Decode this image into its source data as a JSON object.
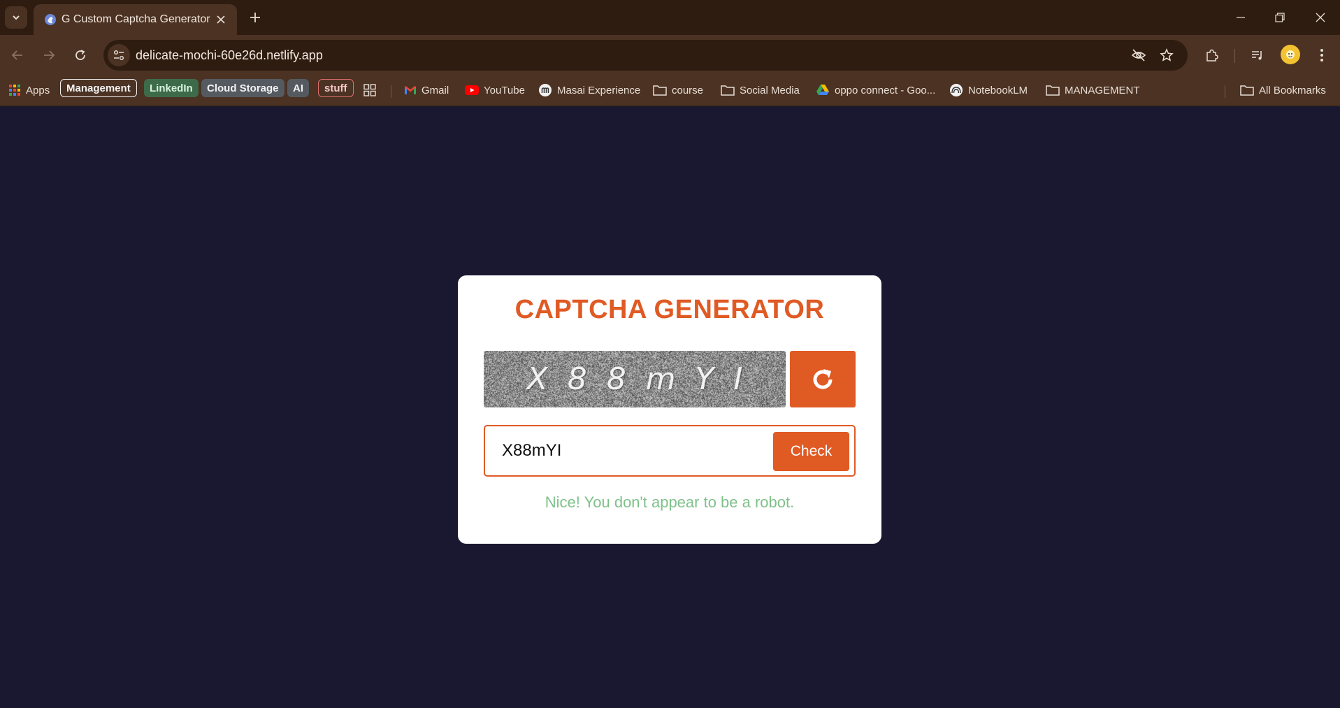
{
  "browser": {
    "tab_title": "G Custom Captcha Generator",
    "url": "delicate-mochi-60e26d.netlify.app"
  },
  "bookmarks": {
    "apps": "Apps",
    "chips": [
      {
        "label": "Management",
        "color": "#ffffff"
      },
      {
        "label": "LinkedIn",
        "color": "#3d6b4a"
      },
      {
        "label": "Cloud Storage",
        "color": "#555a60"
      },
      {
        "label": "AI",
        "color": "#555a60"
      },
      {
        "label": "stuff",
        "color": "#e07070"
      }
    ],
    "items": [
      {
        "label": "Gmail",
        "icon": "gmail-icon"
      },
      {
        "label": "YouTube",
        "icon": "youtube-icon"
      },
      {
        "label": "Masai Experience",
        "icon": "masai-icon"
      },
      {
        "label": "course",
        "icon": "folder-icon"
      },
      {
        "label": "Social Media",
        "icon": "folder-icon"
      },
      {
        "label": "oppo connect - Goo...",
        "icon": "drive-icon"
      },
      {
        "label": "NotebookLM",
        "icon": "notebooklm-icon"
      },
      {
        "label": "MANAGEMENT",
        "icon": "folder-icon"
      }
    ],
    "all_bookmarks": "All Bookmarks"
  },
  "page": {
    "title": "CAPTCHA GENERATOR",
    "captcha_text": "X88mYI",
    "input_value": "X88mYI",
    "check_label": "Check",
    "status_message": "Nice! You don't appear to be a robot.",
    "accent_color": "#e05a24",
    "success_color": "#7fc18a"
  }
}
